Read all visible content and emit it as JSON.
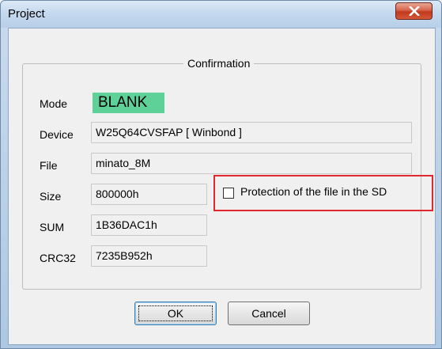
{
  "window": {
    "title": "Project",
    "close_icon": "close-icon"
  },
  "confirmation": {
    "group_title": "Confirmation",
    "fields": {
      "mode": {
        "label": "Mode",
        "value": "BLANK",
        "badge_color": "#5dd197"
      },
      "device": {
        "label": "Device",
        "value": "W25Q64CVSFAP [ Winbond ]"
      },
      "file": {
        "label": "File",
        "value": "minato_8M"
      },
      "size": {
        "label": "Size",
        "value": "800000h"
      },
      "sum": {
        "label": "SUM",
        "value": "1B36DAC1h"
      },
      "crc32": {
        "label": "CRC32",
        "value": "7235B952h"
      }
    },
    "protection": {
      "label": "Protection of the file in the SD",
      "checked": false,
      "highlight_color": "#e0282d"
    }
  },
  "buttons": {
    "ok": "OK",
    "cancel": "Cancel"
  }
}
